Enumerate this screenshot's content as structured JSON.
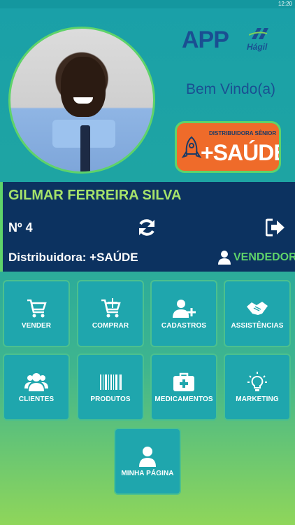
{
  "status": {
    "time": "12:20"
  },
  "header": {
    "logo_app": "APP",
    "logo_brand": "Hágil",
    "welcome": "Bem Vindo(a)",
    "badge_top": "DISTRIBUIDORA SÊNIOR",
    "badge_main": "+SAÚDE"
  },
  "user": {
    "name": "GILMAR FERREIRA SILVA",
    "number": "Nº 4",
    "distributor": "Distribuidora: +SAÚDE",
    "role": "VENDEDOR"
  },
  "menu": [
    {
      "label": "VENDER",
      "icon": "cart-icon"
    },
    {
      "label": "COMPRAR",
      "icon": "cart-add-icon"
    },
    {
      "label": "CADASTROS",
      "icon": "user-add-icon"
    },
    {
      "label": "ASSISTÊNCIAS",
      "icon": "handshake-icon"
    },
    {
      "label": "CLIENTES",
      "icon": "users-icon"
    },
    {
      "label": "PRODUTOS",
      "icon": "barcode-icon"
    },
    {
      "label": "MEDICAMENTOS",
      "icon": "first-aid-icon"
    },
    {
      "label": "MARKETING",
      "icon": "lightbulb-icon"
    },
    {
      "label": "MINHA PÁGINA",
      "icon": "person-icon"
    }
  ],
  "colors": {
    "panel": "#0c3260",
    "accent_green": "#5fd36a",
    "name_green": "#a6e36a",
    "tile": "#1fa6ad",
    "brand_blue": "#1a4f92",
    "badge_orange": "#ef6b2a"
  }
}
